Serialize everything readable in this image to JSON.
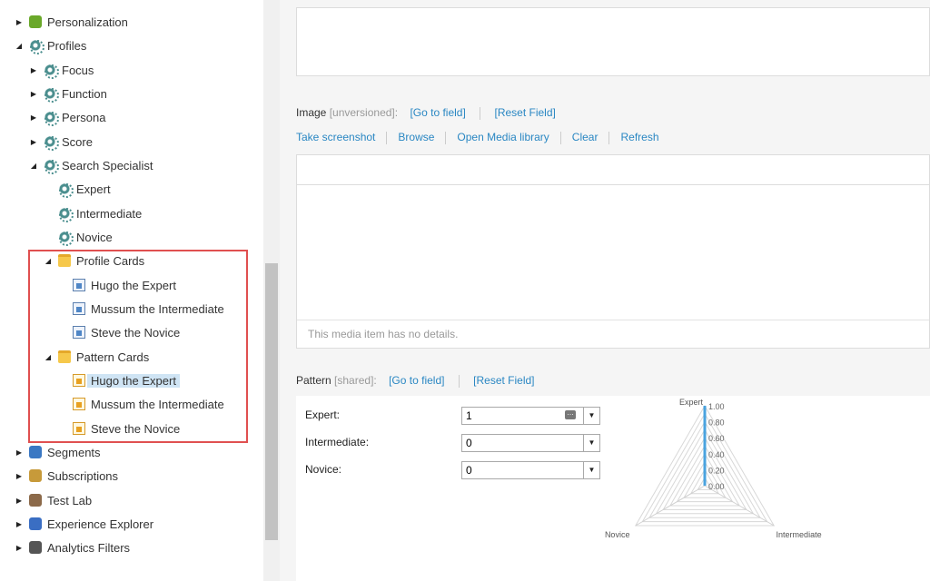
{
  "tree": {
    "items": [
      {
        "label": "Personalization",
        "icon": "personalization-icon"
      },
      {
        "label": "Profiles",
        "icon": "gear-icon"
      },
      {
        "label": "Focus",
        "icon": "gear-icon"
      },
      {
        "label": "Function",
        "icon": "gear-icon"
      },
      {
        "label": "Persona",
        "icon": "gear-icon"
      },
      {
        "label": "Score",
        "icon": "gear-icon"
      },
      {
        "label": "Search Specialist",
        "icon": "gear-icon"
      },
      {
        "label": "Expert",
        "icon": "gear-icon"
      },
      {
        "label": "Intermediate",
        "icon": "gear-icon"
      },
      {
        "label": "Novice",
        "icon": "gear-icon"
      },
      {
        "label": "Profile Cards",
        "icon": "folder-icon"
      },
      {
        "label": "Hugo the Expert",
        "icon": "profile-card-icon"
      },
      {
        "label": "Mussum the Intermediate",
        "icon": "profile-card-icon"
      },
      {
        "label": "Steve the Novice",
        "icon": "profile-card-icon"
      },
      {
        "label": "Pattern Cards",
        "icon": "folder-icon"
      },
      {
        "label": "Hugo the Expert",
        "icon": "pattern-card-icon"
      },
      {
        "label": "Mussum the Intermediate",
        "icon": "pattern-card-icon"
      },
      {
        "label": "Steve the Novice",
        "icon": "pattern-card-icon"
      },
      {
        "label": "Segments",
        "icon": "segments-icon"
      },
      {
        "label": "Subscriptions",
        "icon": "subscriptions-icon"
      },
      {
        "label": "Test Lab",
        "icon": "test-lab-icon"
      },
      {
        "label": "Experience Explorer",
        "icon": "experience-explorer-icon"
      },
      {
        "label": "Analytics Filters",
        "icon": "filter-icon"
      }
    ]
  },
  "image_field": {
    "label": "Image",
    "qualifier": "[unversioned]:",
    "go_to_field": "[Go to field]",
    "reset_field": "[Reset Field]",
    "actions": [
      "Take screenshot",
      "Browse",
      "Open Media library",
      "Clear",
      "Refresh"
    ],
    "details_text": "This media item has no details."
  },
  "pattern_field": {
    "label": "Pattern",
    "qualifier": "[shared]:",
    "go_to_field": "[Go to field]",
    "reset_field": "[Reset Field]",
    "rows": [
      {
        "name": "Expert:",
        "value": "1"
      },
      {
        "name": "Intermediate:",
        "value": "0"
      },
      {
        "name": "Novice:",
        "value": "0"
      }
    ]
  },
  "chart_data": {
    "type": "radar",
    "axes": [
      "Expert",
      "Intermediate",
      "Novice"
    ],
    "values": [
      1,
      0,
      0
    ],
    "ticks": [
      "1.00",
      "0.80",
      "0.60",
      "0.40",
      "0.20",
      "0.00"
    ],
    "range": [
      0,
      1
    ],
    "color": "#4aa3df"
  }
}
